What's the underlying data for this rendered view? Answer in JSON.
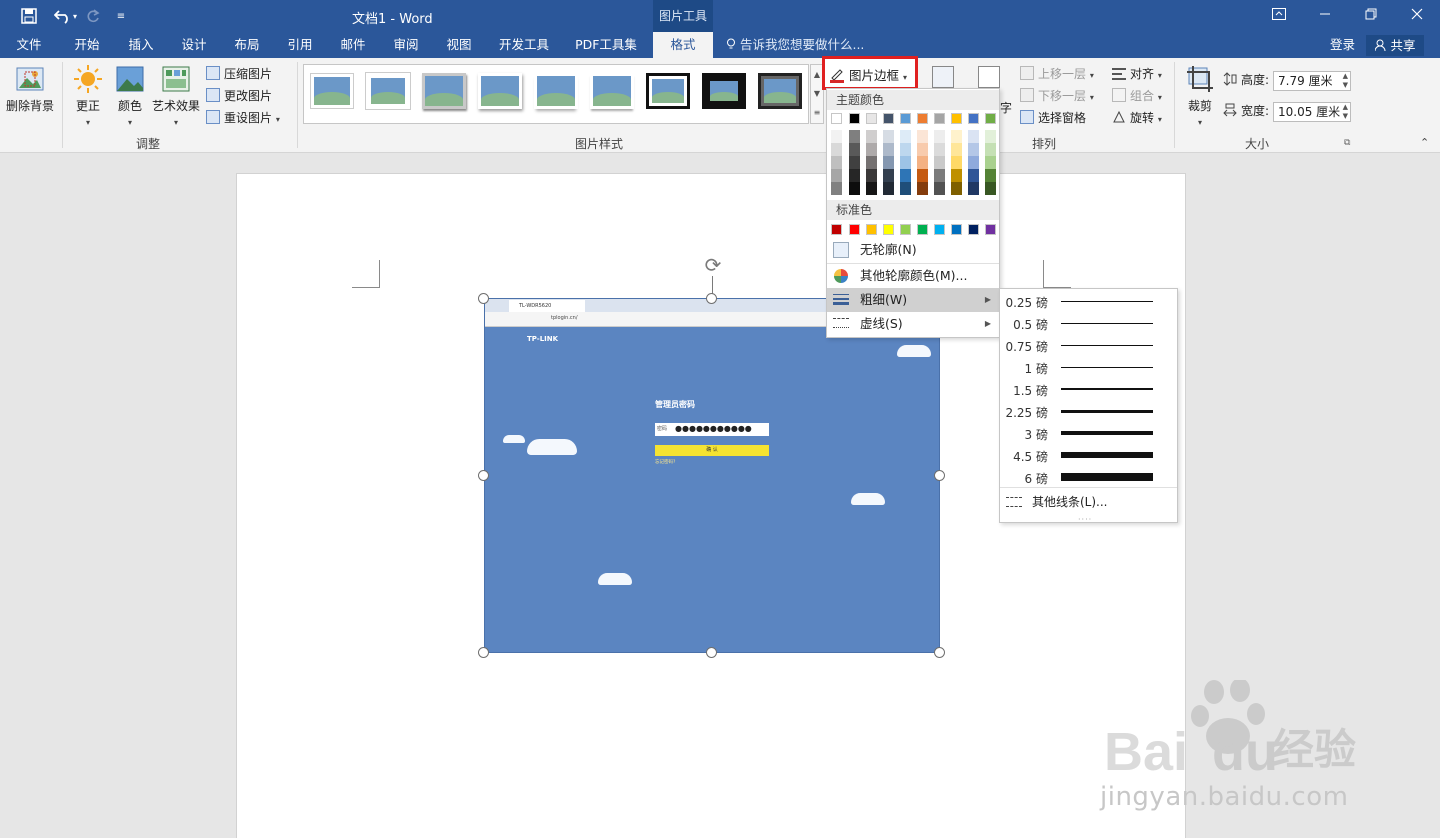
{
  "titlebar": {
    "doc_title": "文档1 - Word",
    "context_tab": "图片工具",
    "qa_caret": "▾",
    "qa_custom": "≡"
  },
  "tabs": [
    "文件",
    "开始",
    "插入",
    "设计",
    "布局",
    "引用",
    "邮件",
    "审阅",
    "视图",
    "开发工具",
    "PDF工具集",
    "格式"
  ],
  "active_tab": "格式",
  "tell_me": "告诉我您想要做什么...",
  "login": "登录",
  "share": "共享",
  "ribbon": {
    "adjust": {
      "remove_bg": "删除背景",
      "corrections": "更正",
      "color": "颜色",
      "artistic": "艺术效果",
      "compress": "压缩图片",
      "change": "更改图片",
      "reset": "重设图片",
      "label": "调整"
    },
    "styles": {
      "label": "图片样式",
      "picture_border": "图片边框"
    },
    "arrange": {
      "text_partial": "字",
      "bring_forward": "上移一层",
      "send_backward": "下移一层",
      "selection_pane": "选择窗格",
      "align": "对齐",
      "group": "组合",
      "rotate": "旋转",
      "label": "排列"
    },
    "size": {
      "crop": "裁剪",
      "height_label": "高度:",
      "height_value": "7.79 厘米",
      "width_label": "宽度:",
      "width_value": "10.05 厘米",
      "label": "大小"
    }
  },
  "picture_content": {
    "tab_title": "TL-WDR5620",
    "url": "tplogin.cn/",
    "brand": "TP-LINK",
    "admin_title": "管理员密码",
    "pw_label": "密码",
    "pw_value": "●●●●●●●●●●●",
    "confirm": "确 认",
    "forgot": "忘记密码?"
  },
  "menu": {
    "theme_colors_label": "主题颜色",
    "standard_colors_label": "标准色",
    "no_outline": "无轮廓(N)",
    "more_colors": "其他轮廓颜色(M)...",
    "weight": "粗细(W)",
    "dashes": "虚线(S)",
    "theme_top": [
      "#ffffff",
      "#000000",
      "#e7e6e6",
      "#44546a",
      "#5b9bd5",
      "#ed7d31",
      "#a5a5a5",
      "#ffc000",
      "#4472c4",
      "#70ad47"
    ],
    "theme_shades": [
      [
        "#f2f2f2",
        "#d9d9d9",
        "#bfbfbf",
        "#a6a6a6",
        "#808080"
      ],
      [
        "#7f7f7f",
        "#595959",
        "#404040",
        "#262626",
        "#0d0d0d"
      ],
      [
        "#d0cece",
        "#aeaaaa",
        "#757171",
        "#3a3838",
        "#171616"
      ],
      [
        "#d6dce4",
        "#adb9ca",
        "#8497b0",
        "#333f4f",
        "#222a35"
      ],
      [
        "#ddebf7",
        "#bdd7ee",
        "#9dc3e6",
        "#2e75b6",
        "#1f4e79"
      ],
      [
        "#fbe5d6",
        "#f8cbad",
        "#f4b183",
        "#c55a11",
        "#843c0c"
      ],
      [
        "#ededed",
        "#dbdbdb",
        "#c9c9c9",
        "#7b7b7b",
        "#525252"
      ],
      [
        "#fff2cc",
        "#ffe699",
        "#ffd966",
        "#bf9000",
        "#7f6000"
      ],
      [
        "#dae3f3",
        "#b4c7e7",
        "#8faadc",
        "#2f5597",
        "#203864"
      ],
      [
        "#e2f0d9",
        "#c5e0b4",
        "#a9d18e",
        "#548235",
        "#385723"
      ]
    ],
    "standard": [
      "#c00000",
      "#ff0000",
      "#ffc000",
      "#ffff00",
      "#92d050",
      "#00b050",
      "#00b0f0",
      "#0070c0",
      "#002060",
      "#7030a0"
    ]
  },
  "weights": [
    {
      "label": "0.25 磅",
      "pt": 0.25
    },
    {
      "label": "0.5 磅",
      "pt": 0.5
    },
    {
      "label": "0.75 磅",
      "pt": 0.75
    },
    {
      "label": "1 磅",
      "pt": 1
    },
    {
      "label": "1.5 磅",
      "pt": 1.5
    },
    {
      "label": "2.25 磅",
      "pt": 2.25
    },
    {
      "label": "3 磅",
      "pt": 3
    },
    {
      "label": "4.5 磅",
      "pt": 4.5
    },
    {
      "label": "6 磅",
      "pt": 6
    }
  ],
  "more_lines": "其他线条(L)...",
  "watermark": {
    "logo_text": "Bai",
    "logo_text2": "du",
    "brand_cn": "经验",
    "url": "jingyan.baidu.com"
  }
}
